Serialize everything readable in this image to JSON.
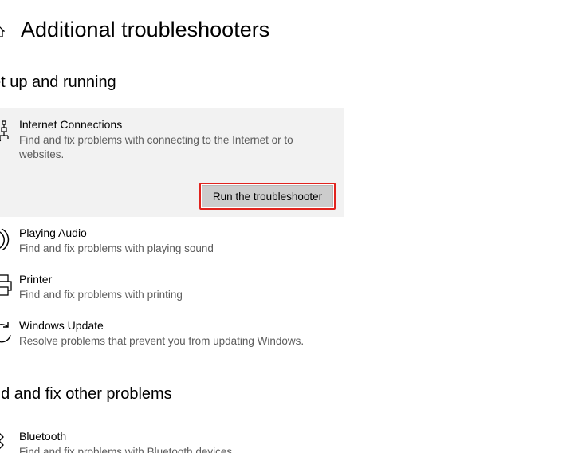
{
  "header": {
    "title": "Additional troubleshooters"
  },
  "sections": [
    {
      "title": "et up and running",
      "items": [
        {
          "icon": "internet-connections-icon",
          "title": "Internet Connections",
          "description": "Find and fix problems with connecting to the Internet or to websites.",
          "expanded": true,
          "button_label": "Run the troubleshooter"
        },
        {
          "icon": "speaker-icon",
          "title": "Playing Audio",
          "description": "Find and fix problems with playing sound"
        },
        {
          "icon": "printer-icon",
          "title": "Printer",
          "description": "Find and fix problems with printing"
        },
        {
          "icon": "windows-update-icon",
          "title": "Windows Update",
          "description": "Resolve problems that prevent you from updating Windows."
        }
      ]
    },
    {
      "title": "nd and fix other problems",
      "items": [
        {
          "icon": "bluetooth-icon",
          "title": "Bluetooth",
          "description": "Find and fix problems with Bluetooth devices"
        }
      ]
    }
  ],
  "colors": {
    "expanded_background": "#f2f2f2",
    "button_background": "#cccccc",
    "highlight_border": "#e1231e",
    "description_text": "#5c5c5c"
  }
}
